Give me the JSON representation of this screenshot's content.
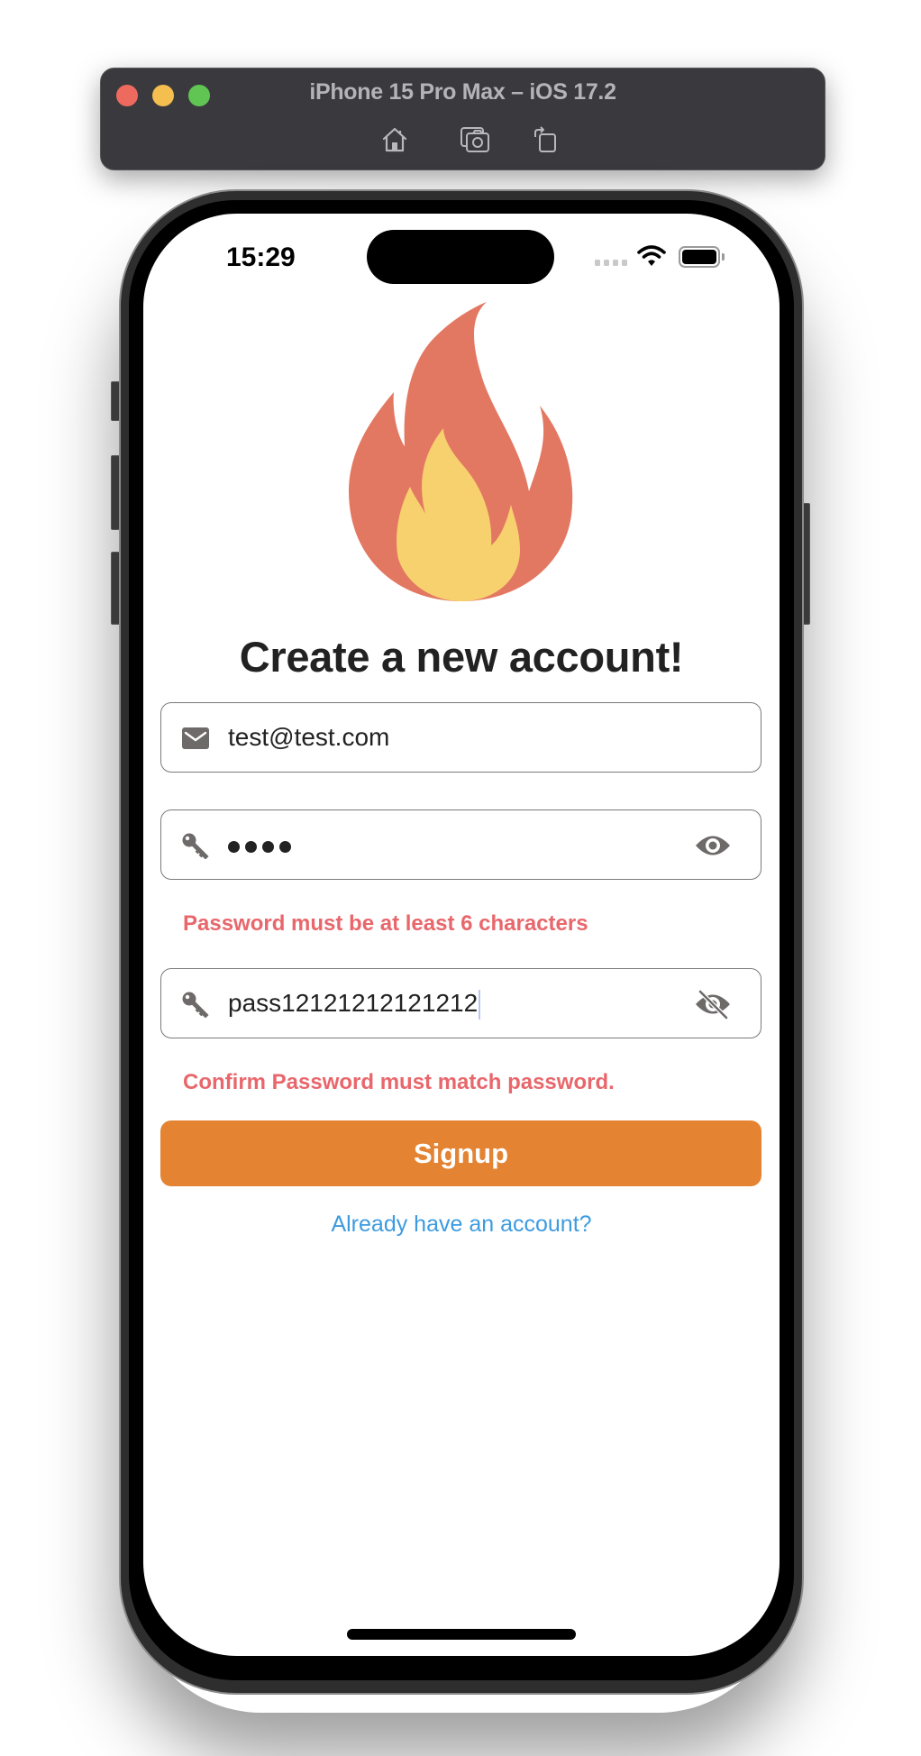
{
  "window": {
    "title": "iPhone 15 Pro Max – iOS 17.2",
    "traffic_lights": [
      "close",
      "minimize",
      "zoom"
    ],
    "toolbar": [
      {
        "name": "home",
        "icon": "home-icon"
      },
      {
        "name": "screenshot",
        "icon": "camera-icon"
      },
      {
        "name": "rotate",
        "icon": "rotate-icon"
      }
    ]
  },
  "status_bar": {
    "time": "15:29",
    "icons": [
      "signal-dots-icon",
      "wifi-icon",
      "battery-icon"
    ]
  },
  "app": {
    "logo": "flame-icon",
    "title": "Create a new account!",
    "fields": {
      "email": {
        "icon": "email-icon",
        "value": "test@test.com"
      },
      "password": {
        "icon": "key-icon",
        "masked_length": 4,
        "toggle_icon": "eye-icon",
        "error": "Password must be at least 6 characters"
      },
      "confirm_password": {
        "icon": "key-icon",
        "value": "pass12121212121212",
        "toggle_icon": "eye-off-icon",
        "error": "Confirm Password must match password."
      }
    },
    "signup_label": "Signup",
    "login_link": "Already have an account?"
  },
  "colors": {
    "accent": "#e48332",
    "error": "#e8676c",
    "link": "#3d9be0",
    "flame_outer": "#e37862",
    "flame_inner": "#f8d16f"
  }
}
